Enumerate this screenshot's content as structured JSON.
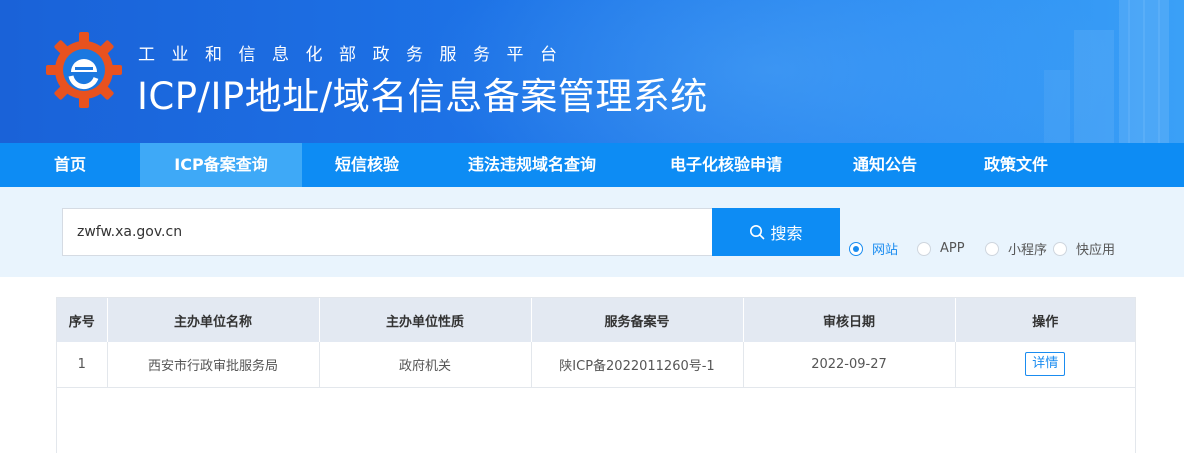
{
  "header": {
    "subtitle": "工业和信息化部政务服务平台",
    "title": "ICP/IP地址/域名信息备案管理系统"
  },
  "nav": {
    "items": [
      {
        "label": "首页",
        "active": false
      },
      {
        "label": "ICP备案查询",
        "active": true
      },
      {
        "label": "短信核验",
        "active": false
      },
      {
        "label": "违法违规域名查询",
        "active": false
      },
      {
        "label": "电子化核验申请",
        "active": false
      },
      {
        "label": "通知公告",
        "active": false
      },
      {
        "label": "政策文件",
        "active": false
      }
    ]
  },
  "search": {
    "value": "zwfw.xa.gov.cn",
    "button_label": "搜索",
    "options": [
      {
        "label": "网站",
        "checked": true
      },
      {
        "label": "APP",
        "checked": false
      },
      {
        "label": "小程序",
        "checked": false
      },
      {
        "label": "快应用",
        "checked": false
      }
    ]
  },
  "table": {
    "headers": [
      "序号",
      "主办单位名称",
      "主办单位性质",
      "服务备案号",
      "审核日期",
      "操作"
    ],
    "rows": [
      {
        "index": "1",
        "org_name": "西安市行政审批服务局",
        "org_type": "政府机关",
        "record_no": "陕ICP备2022011260号-1",
        "date": "2022-09-27",
        "action": "详情"
      }
    ]
  },
  "colors": {
    "nav_bg": "#0d8cf4",
    "nav_active": "#3ea9f7",
    "search_bg": "#e9f4fd",
    "accent": "#1a8cf0",
    "table_header_bg": "#e3e9f2"
  }
}
